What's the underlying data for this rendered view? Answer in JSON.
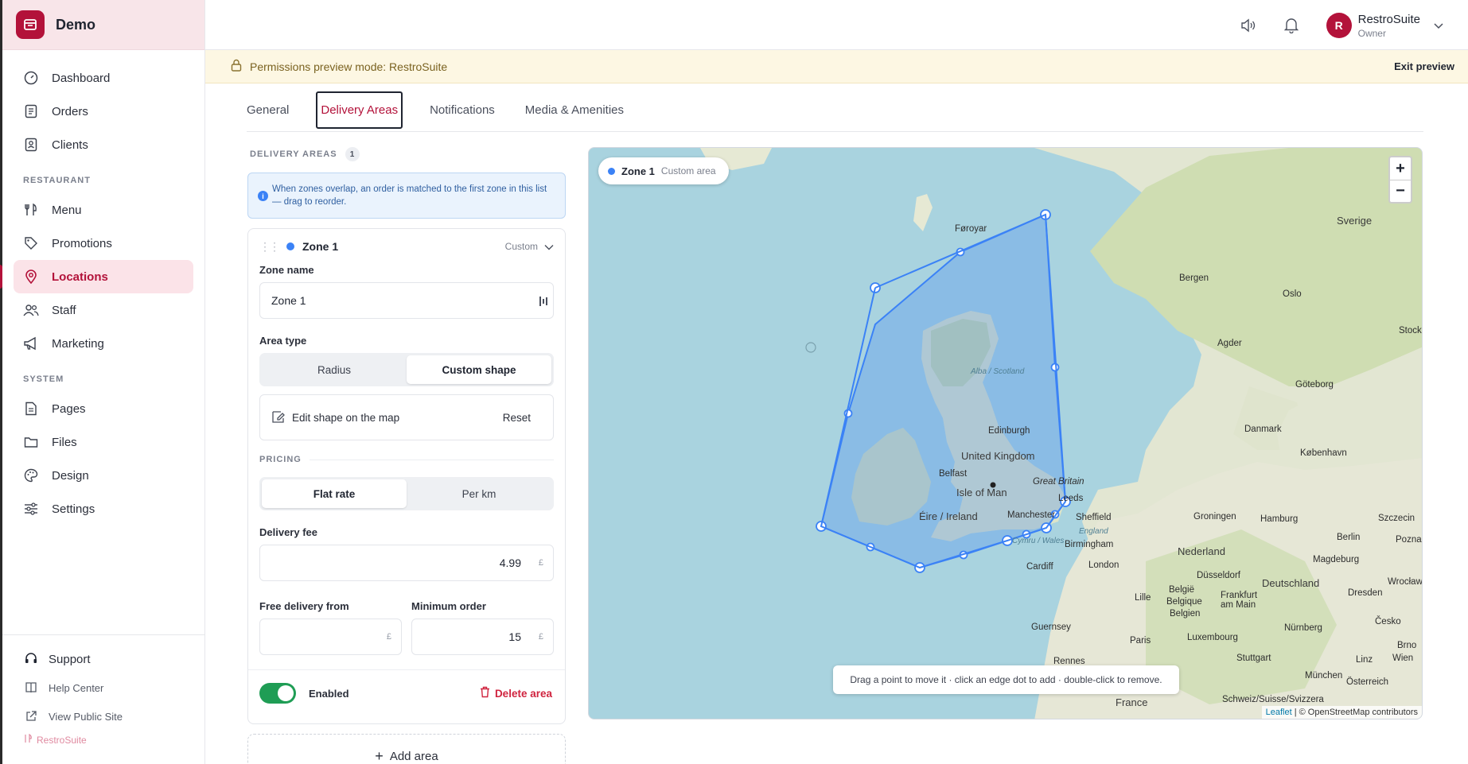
{
  "brand": {
    "name": "Demo"
  },
  "sidebar": {
    "items": [
      {
        "label": "Dashboard",
        "icon": "dashboard-icon"
      },
      {
        "label": "Orders",
        "icon": "orders-icon"
      },
      {
        "label": "Clients",
        "icon": "clients-icon"
      }
    ],
    "section_restaurant": "RESTAURANT",
    "restaurant_items": [
      {
        "label": "Menu",
        "icon": "menu-icon"
      },
      {
        "label": "Promotions",
        "icon": "tag-icon"
      },
      {
        "label": "Locations",
        "icon": "location-pin-icon",
        "active": true
      },
      {
        "label": "Staff",
        "icon": "staff-icon"
      },
      {
        "label": "Marketing",
        "icon": "megaphone-icon"
      }
    ],
    "section_system": "SYSTEM",
    "system_items": [
      {
        "label": "Pages",
        "icon": "pages-icon"
      },
      {
        "label": "Files",
        "icon": "folder-icon"
      },
      {
        "label": "Design",
        "icon": "palette-icon"
      },
      {
        "label": "Settings",
        "icon": "sliders-icon"
      }
    ],
    "footer": {
      "support": "Support",
      "help": "Help Center",
      "public_site": "View Public Site",
      "powered_by": "RestroSuite"
    }
  },
  "topbar": {
    "user_initial": "R",
    "user_name": "RestroSuite",
    "user_role": "Owner"
  },
  "banner": {
    "text": "Permissions preview mode: RestroSuite",
    "exit_label": "Exit preview"
  },
  "tabs": [
    "General",
    "Delivery Areas",
    "Notifications",
    "Media & Amenities"
  ],
  "delivery": {
    "section_title": "DELIVERY AREAS",
    "count": "1",
    "info_text": "When zones overlap, an order is matched to the first zone in this list — drag to reorder.",
    "zone": {
      "name": "Zone 1",
      "type_label": "Custom",
      "zone_name_label": "Zone name",
      "zone_name_value": "Zone 1",
      "area_type_label": "Area type",
      "area_type_options": [
        "Radius",
        "Custom shape"
      ],
      "area_type_selected": "Custom shape",
      "edit_shape_label": "Edit shape on the map",
      "reset_label": "Reset",
      "pricing_title": "PRICING",
      "pricing_options": [
        "Flat rate",
        "Per km"
      ],
      "pricing_selected": "Flat rate",
      "delivery_fee_label": "Delivery fee",
      "delivery_fee_value": "4.99",
      "currency": "£",
      "free_delivery_label": "Free delivery from",
      "free_delivery_value": "",
      "minimum_order_label": "Minimum order",
      "minimum_order_value": "15",
      "enabled_label": "Enabled",
      "enabled": true,
      "delete_label": "Delete area"
    },
    "add_area_label": "Add area"
  },
  "map": {
    "pill_name": "Zone 1",
    "pill_type": "Custom area",
    "zoom_in": "+",
    "zoom_out": "−",
    "hint": "Drag a point to move it · click an edge dot to add · double-click to remove.",
    "attribution_leaflet": "Leaflet",
    "attribution_osm": "| © OpenStreetMap contributors",
    "zone_color": "#3b82f6",
    "labels": {
      "faroe": "Føroyar",
      "alba": "Alba / Scotland",
      "edinburgh": "Edinburgh",
      "uk": "United Kingdom",
      "belfast": "Belfast",
      "gb": "Great Britain",
      "isle_of_man": "Isle of Man",
      "ireland": "Éire / Ireland",
      "manchester": "Manchester",
      "leeds": "Leeds",
      "sheffield": "Sheffield",
      "england": "England",
      "birmingham": "Birmingham",
      "wales": "Cymru / Wales",
      "cardiff": "Cardiff",
      "london": "London",
      "guernsey": "Guernsey",
      "rennes": "Rennes",
      "paris": "Paris",
      "lille": "Lille",
      "france": "France",
      "bergen": "Bergen",
      "oslo": "Oslo",
      "sverige": "Sverige",
      "goteborg": "Göteborg",
      "danmark": "Danmark",
      "kobenhavn": "København",
      "groningen": "Groningen",
      "hamburg": "Hamburg",
      "nederland": "Nederland",
      "belgie": "België",
      "belgique": "Belgique",
      "belgien": "Belgien",
      "deutschland": "Deutschland",
      "berlin": "Berlin",
      "dusseldorf": "Düsseldorf",
      "frankfurt": "Frankfurt am Main",
      "luxembourg": "Luxembourg",
      "stuttgart": "Stuttgart",
      "munchen": "München",
      "nurnberg": "Nürnberg",
      "magdeburg": "Magdeburg",
      "dresden": "Dresden",
      "cesko": "Česko",
      "szczecin": "Szczecin",
      "poznan": "Poznań",
      "wroclaw": "Wrocław",
      "brno": "Brno",
      "wien": "Wien",
      "linz": "Linz",
      "osterreich": "Österreich",
      "schweiz": "Schweiz/Suisse/Svizzera",
      "agder": "Agder",
      "stock": "Stock"
    }
  }
}
